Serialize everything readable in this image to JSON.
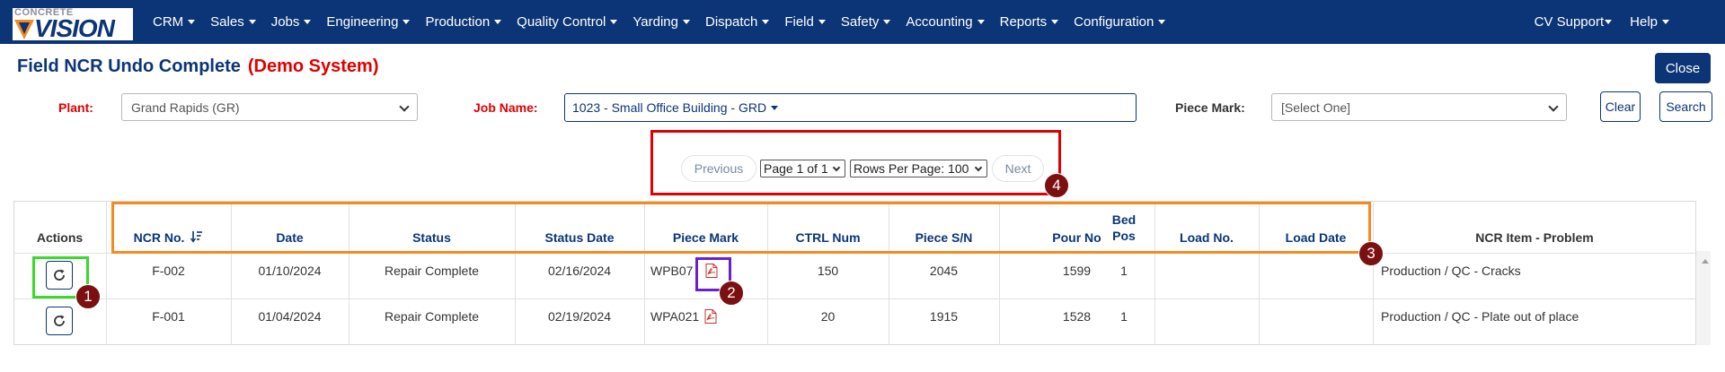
{
  "nav": {
    "logo_top": "CONCRETE",
    "logo_bottom": "VISION",
    "items": [
      "CRM",
      "Sales",
      "Jobs",
      "Engineering",
      "Production",
      "Quality Control",
      "Yarding",
      "Dispatch",
      "Field",
      "Safety",
      "Accounting",
      "Reports",
      "Configuration"
    ],
    "right_items": [
      "CV Support",
      "Help"
    ]
  },
  "header": {
    "title": "Field NCR Undo Complete",
    "demo": "(Demo System)",
    "close_label": "Close"
  },
  "filters": {
    "plant_label": "Plant:",
    "plant_value": "Grand Rapids (GR)",
    "job_label": "Job Name:",
    "job_value": "1023 - Small Office Building - GRD",
    "piece_label": "Piece Mark:",
    "piece_value": "[Select One]",
    "clear_label": "Clear",
    "search_label": "Search"
  },
  "pager": {
    "previous": "Previous",
    "page_select": "Page 1 of 1",
    "rows_select": "Rows Per Page: 100",
    "next": "Next"
  },
  "badges": [
    "1",
    "2",
    "3",
    "4"
  ],
  "table": {
    "headers": {
      "actions": "Actions",
      "ncr_no": "NCR No.",
      "date": "Date",
      "status": "Status",
      "status_date": "Status Date",
      "piece_mark": "Piece Mark",
      "ctrl_num": "CTRL Num",
      "piece_sn": "Piece S/N",
      "pour_no": "Pour No",
      "bed_pos_1": "Bed",
      "bed_pos_2": "Pos",
      "load_no": "Load No.",
      "load_date": "Load Date",
      "ncr_item": "NCR Item - Problem"
    },
    "rows": [
      {
        "ncr_no": "F-002",
        "date": "01/10/2024",
        "status": "Repair Complete",
        "status_date": "02/16/2024",
        "piece_mark": "WPB07",
        "ctrl_num": "150",
        "piece_sn": "2045",
        "pour_no": "1599",
        "bed_pos": "1",
        "load_no": "",
        "load_date": "",
        "ncr_item": "Production / QC - Cracks"
      },
      {
        "ncr_no": "F-001",
        "date": "01/04/2024",
        "status": "Repair Complete",
        "status_date": "02/19/2024",
        "piece_mark": "WPA021",
        "ctrl_num": "20",
        "piece_sn": "1915",
        "pour_no": "1528",
        "bed_pos": "1",
        "load_no": "",
        "load_date": "",
        "ncr_item": "Production / QC - Plate out of place"
      }
    ]
  }
}
